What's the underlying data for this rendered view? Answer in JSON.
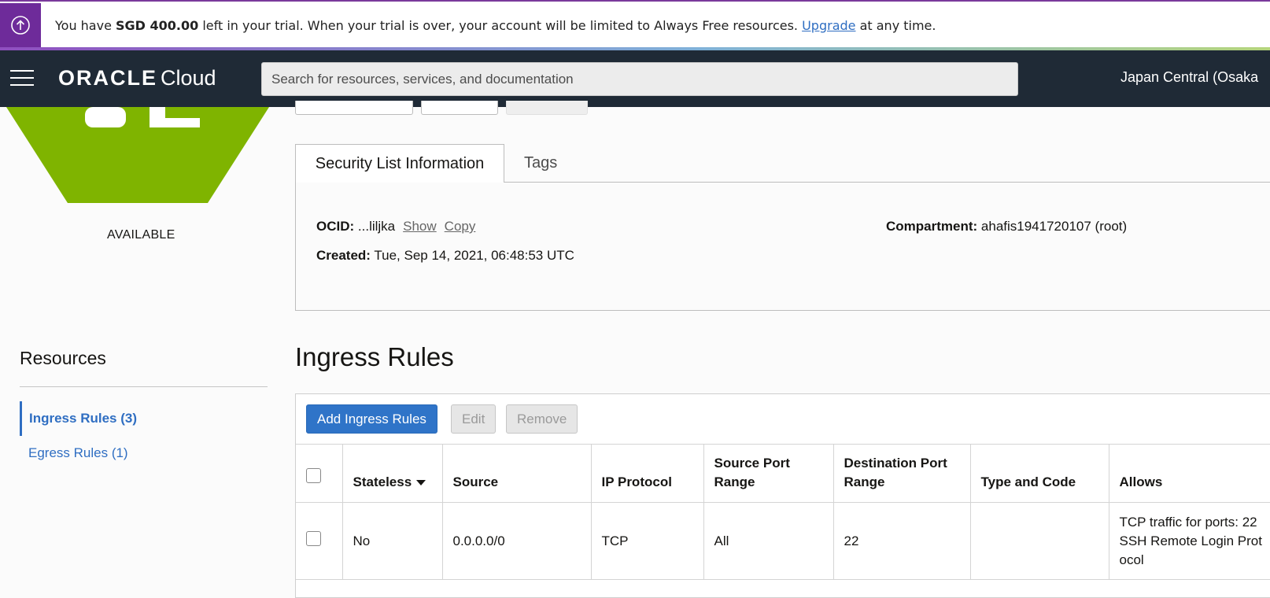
{
  "banner": {
    "icon": "arrow-up-circle-icon",
    "text_prefix": "You have ",
    "amount": "SGD 400.00",
    "text_middle": " left in your trial. When your trial is over, your account will be limited to Always Free resources. ",
    "link": "Upgrade",
    "text_suffix": " at any time."
  },
  "nav": {
    "logo_brand": "ORACLE",
    "logo_product": "Cloud",
    "search_placeholder": "Search for resources, services, and documentation",
    "region": "Japan Central (Osaka"
  },
  "sidebar": {
    "status": "AVAILABLE",
    "resources_title": "Resources",
    "items": [
      {
        "label": "Ingress Rules (3)",
        "active": true
      },
      {
        "label": "Egress Rules (1)",
        "active": false
      }
    ]
  },
  "details": {
    "tabs": [
      "Security List Information",
      "Tags"
    ],
    "ocid_label": "OCID:",
    "ocid_value": "...liljka",
    "show_link": "Show",
    "copy_link": "Copy",
    "created_label": "Created:",
    "created_value": "Tue, Sep 14, 2021, 06:48:53 UTC",
    "compartment_label": "Compartment:",
    "compartment_value": "ahafis1941720107 (root)"
  },
  "ingress": {
    "title": "Ingress Rules",
    "buttons": {
      "add": "Add Ingress Rules",
      "edit": "Edit",
      "remove": "Remove"
    },
    "columns": [
      "Stateless",
      "Source",
      "IP Protocol",
      "Source Port Range",
      "Destination Port Range",
      "Type and Code",
      "Allows"
    ],
    "rows": [
      {
        "stateless": "No",
        "source": "0.0.0.0/0",
        "protocol": "TCP",
        "source_port": "All",
        "dest_port": "22",
        "type_code": "",
        "allows": "TCP traffic for ports: 22 SSH Remote Login Prot ocol"
      }
    ]
  },
  "colors": {
    "banner_accent": "#6e2b9a",
    "nav_bg": "#1f2a36",
    "hexagon": "#7fb400",
    "link": "#2f6ec2",
    "primary_button": "#2f74c8"
  }
}
